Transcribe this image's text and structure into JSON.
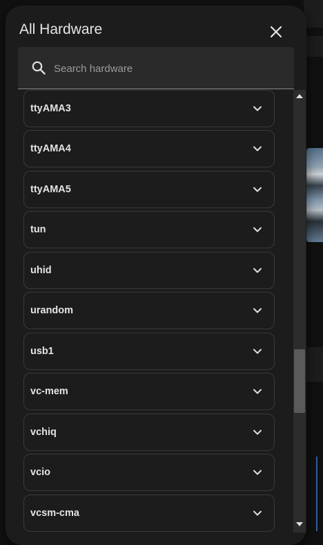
{
  "dialog": {
    "title": "All Hardware",
    "close_icon": "close-icon"
  },
  "search": {
    "placeholder": "Search hardware",
    "value": "",
    "icon": "search-icon"
  },
  "items": [
    {
      "label": "ttyAMA3"
    },
    {
      "label": "ttyAMA4"
    },
    {
      "label": "ttyAMA5"
    },
    {
      "label": "tun"
    },
    {
      "label": "uhid"
    },
    {
      "label": "urandom"
    },
    {
      "label": "usb1"
    },
    {
      "label": "vc-mem"
    },
    {
      "label": "vchiq"
    },
    {
      "label": "vcio"
    },
    {
      "label": "vcsm-cma"
    }
  ],
  "item_icon": "chevron-down-icon",
  "scrollbar": {
    "position": 0.72
  },
  "colors": {
    "dialog_bg": "#1c1c1c",
    "item_border": "#3a3a3a",
    "text": "#e4e4e4",
    "accent_line": "#2b6fd6"
  }
}
